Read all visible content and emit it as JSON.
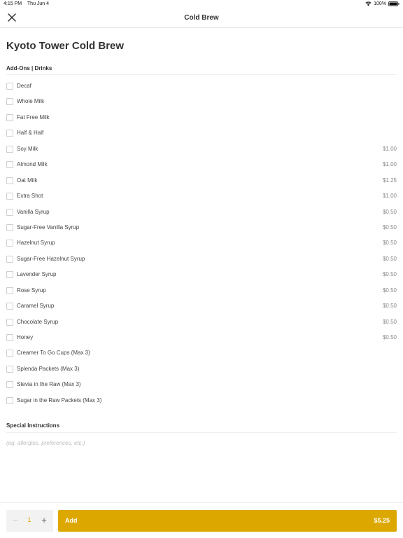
{
  "status_bar": {
    "time": "4:15 PM",
    "date": "Thu Jun 4",
    "battery": "100%"
  },
  "nav": {
    "title": "Cold Brew",
    "close_icon": "close-icon"
  },
  "product": {
    "title": "Kyoto Tower Cold Brew"
  },
  "addons": {
    "header": "Add-Ons | Drinks",
    "items": [
      {
        "label": "Decaf",
        "price": ""
      },
      {
        "label": "Whole Milk",
        "price": ""
      },
      {
        "label": "Fat Free Milk",
        "price": ""
      },
      {
        "label": "Half & Half",
        "price": ""
      },
      {
        "label": "Soy Milk",
        "price": "$1.00"
      },
      {
        "label": "Almond Milk",
        "price": "$1.00"
      },
      {
        "label": "Oat Milk",
        "price": "$1.25"
      },
      {
        "label": "Extra Shot",
        "price": "$1.00"
      },
      {
        "label": "Vanilla Syrup",
        "price": "$0.50"
      },
      {
        "label": "Sugar-Free Vanilla Syrup",
        "price": "$0.50"
      },
      {
        "label": "Hazelnut Syrup",
        "price": "$0.50"
      },
      {
        "label": "Sugar-Free Hazelnut Syrup",
        "price": "$0.50"
      },
      {
        "label": "Lavender Syrup",
        "price": "$0.50"
      },
      {
        "label": "Rose Syrup",
        "price": "$0.50"
      },
      {
        "label": "Caramel Syrup",
        "price": "$0.50"
      },
      {
        "label": "Chocolate Syrup",
        "price": "$0.50"
      },
      {
        "label": "Honey",
        "price": "$0.50"
      },
      {
        "label": "Creamer To Go Cups (Max 3)",
        "price": ""
      },
      {
        "label": "Splenda Packets (Max 3)",
        "price": ""
      },
      {
        "label": "Stevia in the Raw (Max 3)",
        "price": ""
      },
      {
        "label": "Sugar in the Raw Packets (Max 3)",
        "price": ""
      }
    ]
  },
  "special": {
    "header": "Special Instructions",
    "placeholder": "(eg. allergies, preferences, etc.)",
    "value": ""
  },
  "footer": {
    "quantity": "1",
    "minus": "−",
    "plus": "+",
    "add_label": "Add",
    "add_price": "$5.25"
  },
  "colors": {
    "accent": "#dca800",
    "text": "#333333",
    "muted": "#888888"
  }
}
